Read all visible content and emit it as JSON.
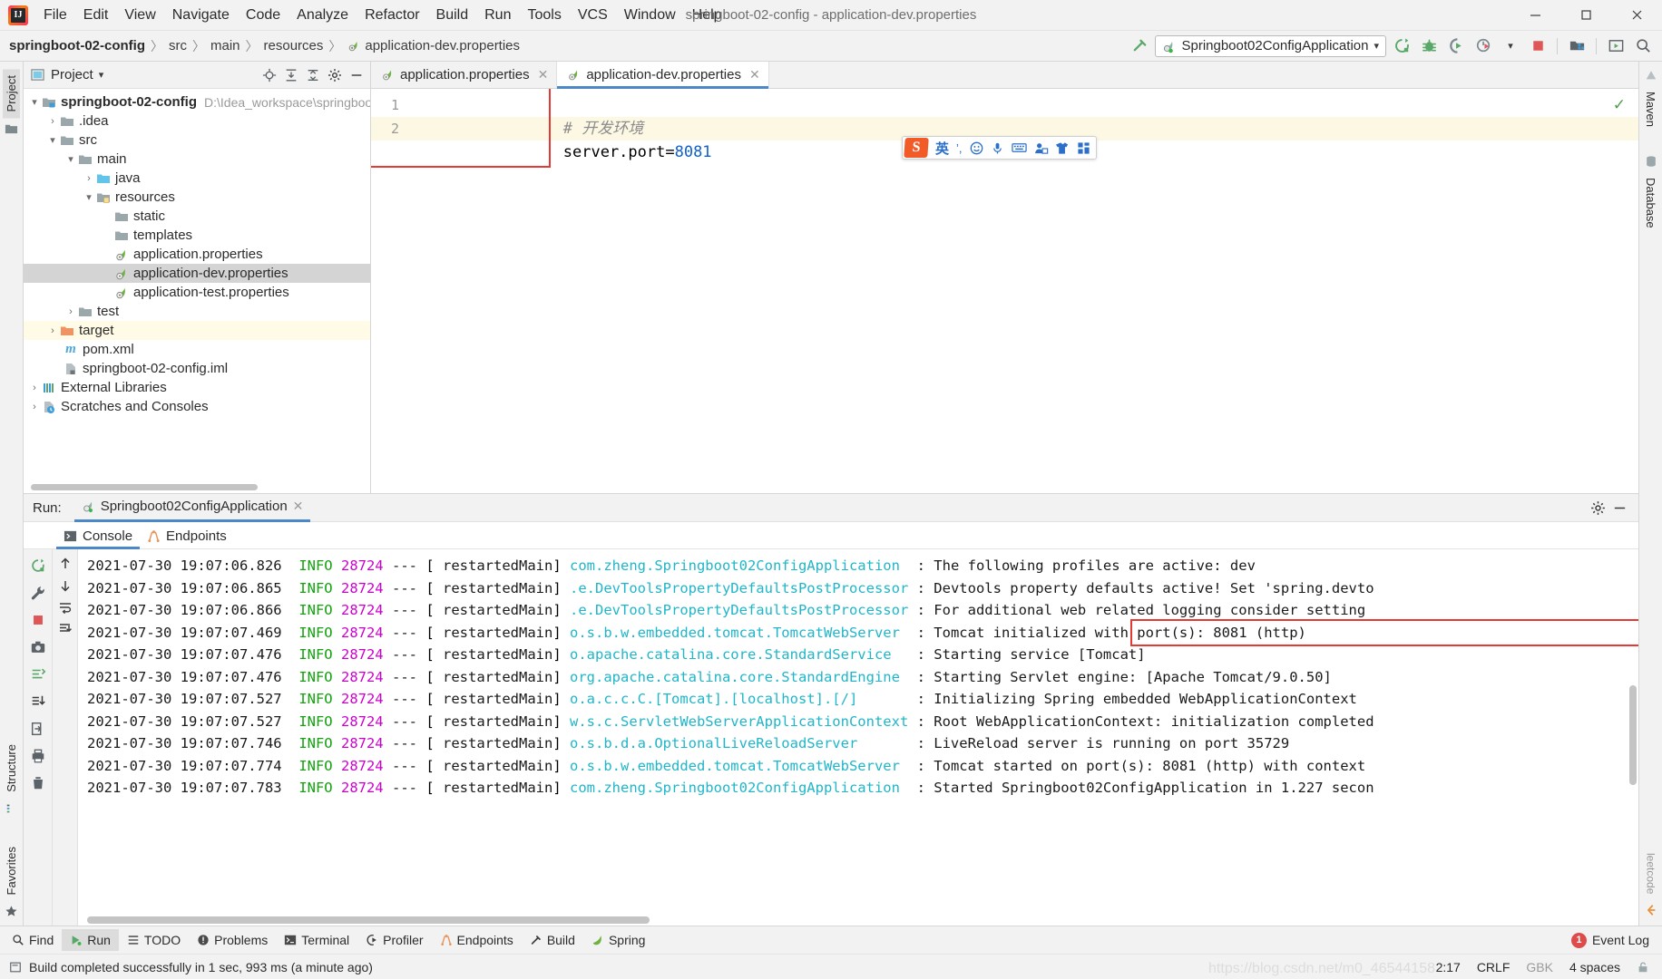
{
  "window": {
    "title": "springboot-02-config - application-dev.properties",
    "logo_text": "IJ",
    "minimize": "─",
    "maximize": "☐",
    "close": "✕"
  },
  "menubar": [
    {
      "label": "File"
    },
    {
      "label": "Edit"
    },
    {
      "label": "View"
    },
    {
      "label": "Navigate"
    },
    {
      "label": "Code"
    },
    {
      "label": "Analyze"
    },
    {
      "label": "Refactor"
    },
    {
      "label": "Build"
    },
    {
      "label": "Run"
    },
    {
      "label": "Tools"
    },
    {
      "label": "VCS"
    },
    {
      "label": "Window"
    },
    {
      "label": "Help"
    }
  ],
  "breadcrumb": {
    "items": [
      "springboot-02-config",
      "src",
      "main",
      "resources",
      "application-dev.properties"
    ],
    "separator": "〉"
  },
  "toolbar": {
    "run_config_name": "Springboot02ConfigApplication",
    "dropdown_caret": "▾",
    "icons": [
      {
        "name": "build-hammer-icon"
      },
      {
        "name": "rerun-icon"
      },
      {
        "name": "debug-icon"
      },
      {
        "name": "run-coverage-icon"
      },
      {
        "name": "profiler-icon"
      },
      {
        "name": "stop-icon"
      },
      {
        "name": "project-structure-icon"
      },
      {
        "name": "updates-icon"
      },
      {
        "name": "search-everywhere-icon"
      }
    ]
  },
  "left_rail": [
    {
      "label": "Project",
      "selected": true
    },
    {
      "label": "Favorites",
      "selected": false
    },
    {
      "label": "Structure",
      "selected": false
    }
  ],
  "right_rail": [
    {
      "label": "Maven"
    },
    {
      "label": "Database"
    }
  ],
  "project_panel": {
    "title": "Project",
    "caret": "▾",
    "header_icons": [
      "locate-icon",
      "expand-all-icon",
      "collapse-all-icon",
      "settings-gear-icon",
      "hide-icon"
    ],
    "tree": [
      {
        "depth": 0,
        "arrow": "v",
        "icon": "module-folder-icon",
        "label": "springboot-02-config",
        "bold": true,
        "path": "D:\\Idea_workspace\\springboot-",
        "state": "normal"
      },
      {
        "depth": 1,
        "arrow": ">",
        "icon": "folder-icon",
        "label": ".idea",
        "bold": false,
        "path": "",
        "state": "normal"
      },
      {
        "depth": 1,
        "arrow": "v",
        "icon": "folder-icon",
        "label": "src",
        "bold": false,
        "path": "",
        "state": "normal"
      },
      {
        "depth": 2,
        "arrow": "v",
        "icon": "folder-icon",
        "label": "main",
        "bold": false,
        "path": "",
        "state": "normal"
      },
      {
        "depth": 3,
        "arrow": ">",
        "icon": "source-folder-icon",
        "label": "java",
        "bold": false,
        "path": "",
        "state": "normal"
      },
      {
        "depth": 3,
        "arrow": "v",
        "icon": "resource-folder-icon",
        "label": "resources",
        "bold": false,
        "path": "",
        "state": "normal"
      },
      {
        "depth": 4,
        "arrow": "",
        "icon": "folder-icon",
        "label": "static",
        "bold": false,
        "path": "",
        "state": "normal"
      },
      {
        "depth": 4,
        "arrow": "",
        "icon": "folder-icon",
        "label": "templates",
        "bold": false,
        "path": "",
        "state": "normal"
      },
      {
        "depth": 4,
        "arrow": "",
        "icon": "spring-properties-icon",
        "label": "application.properties",
        "bold": false,
        "path": "",
        "state": "normal"
      },
      {
        "depth": 4,
        "arrow": "",
        "icon": "spring-properties-icon",
        "label": "application-dev.properties",
        "bold": false,
        "path": "",
        "state": "selected"
      },
      {
        "depth": 4,
        "arrow": "",
        "icon": "spring-properties-icon",
        "label": "application-test.properties",
        "bold": false,
        "path": "",
        "state": "normal"
      },
      {
        "depth": 2,
        "arrow": ">",
        "icon": "folder-icon",
        "label": "test",
        "bold": false,
        "path": "",
        "state": "normal"
      },
      {
        "depth": 1,
        "arrow": ">",
        "icon": "target-folder-icon",
        "label": "target",
        "bold": false,
        "path": "",
        "state": "highlight"
      },
      {
        "depth": 1,
        "arrow": "",
        "icon": "maven-pom-icon",
        "label": "pom.xml",
        "bold": false,
        "path": "",
        "state": "normal"
      },
      {
        "depth": 1,
        "arrow": "",
        "icon": "iml-icon",
        "label": "springboot-02-config.iml",
        "bold": false,
        "path": "",
        "state": "normal"
      },
      {
        "depth": 0,
        "arrow": ">",
        "icon": "external-libraries-icon",
        "label": "External Libraries",
        "bold": false,
        "path": "",
        "state": "normal"
      },
      {
        "depth": 0,
        "arrow": ">",
        "icon": "scratches-icon",
        "label": "Scratches and Consoles",
        "bold": false,
        "path": "",
        "state": "normal"
      }
    ]
  },
  "editor": {
    "tabs": [
      {
        "label": "application.properties",
        "icon": "spring-properties-icon",
        "active": false,
        "close": "✕"
      },
      {
        "label": "application-dev.properties",
        "icon": "spring-properties-icon",
        "active": true,
        "close": "✕"
      }
    ],
    "gutter": [
      "1",
      "2"
    ],
    "lines": [
      {
        "num": "1",
        "segments": [
          {
            "text": "# 开发环境",
            "cls": "cmt"
          }
        ],
        "highlight": false
      },
      {
        "num": "2",
        "segments": [
          {
            "text": "server.port=",
            "cls": "plain"
          },
          {
            "text": "8081",
            "cls": "num"
          }
        ],
        "highlight": true
      }
    ],
    "inspection_status": "✓",
    "ime": {
      "logo": "S",
      "mode": "英",
      "items": [
        "punctuation-icon",
        "emoji-icon",
        "microphone-icon",
        "keyboard-icon",
        "user-icon",
        "skin-icon",
        "apps-icon"
      ],
      "mode_punct": "’,"
    }
  },
  "run_tool": {
    "label": "Run:",
    "config_tab": "Springboot02ConfigApplication",
    "config_tab_close": "✕",
    "tabs": [
      {
        "label": "Console",
        "icon": "console-icon",
        "active": true
      },
      {
        "label": "Endpoints",
        "icon": "endpoints-icon",
        "active": false
      }
    ],
    "header_icons": [
      "settings-gear-icon",
      "hide-icon"
    ],
    "side_icons": [
      "rerun-icon",
      "stop-icon",
      "screenshot-icon",
      "thread-dump-icon",
      "export-icon",
      "print-icon",
      "trash-icon"
    ],
    "gutter_icons": [
      "scroll-up-icon",
      "scroll-down-icon",
      "soft-wrap-icon",
      "scroll-to-end-icon"
    ],
    "console_lines": [
      {
        "date": "2021-07-30 19:07:06.826",
        "level": "INFO",
        "pid": "28724",
        "thread": "restartedMain",
        "logger": "com.zheng.Springboot02ConfigApplication",
        "message": ": The following profiles are active: dev",
        "highlight": false
      },
      {
        "date": "2021-07-30 19:07:06.865",
        "level": "INFO",
        "pid": "28724",
        "thread": "restartedMain",
        "logger": ".e.DevToolsPropertyDefaultsPostProcessor",
        "message": ": Devtools property defaults active! Set 'spring.devto",
        "highlight": false
      },
      {
        "date": "2021-07-30 19:07:06.866",
        "level": "INFO",
        "pid": "28724",
        "thread": "restartedMain",
        "logger": ".e.DevToolsPropertyDefaultsPostProcessor",
        "message": ": For additional web related logging consider setting",
        "highlight": false
      },
      {
        "date": "2021-07-30 19:07:07.469",
        "level": "INFO",
        "pid": "28724",
        "thread": "restartedMain",
        "logger": "o.s.b.w.embedded.tomcat.TomcatWebServer",
        "message": ": Tomcat initialized with port(s): 8081 (http)",
        "highlight": true
      },
      {
        "date": "2021-07-30 19:07:07.476",
        "level": "INFO",
        "pid": "28724",
        "thread": "restartedMain",
        "logger": "o.apache.catalina.core.StandardService",
        "message": ": Starting service [Tomcat]",
        "highlight": false
      },
      {
        "date": "2021-07-30 19:07:07.476",
        "level": "INFO",
        "pid": "28724",
        "thread": "restartedMain",
        "logger": "org.apache.catalina.core.StandardEngine",
        "message": ": Starting Servlet engine: [Apache Tomcat/9.0.50]",
        "highlight": false
      },
      {
        "date": "2021-07-30 19:07:07.527",
        "level": "INFO",
        "pid": "28724",
        "thread": "restartedMain",
        "logger": "o.a.c.c.C.[Tomcat].[localhost].[/]",
        "message": ": Initializing Spring embedded WebApplicationContext",
        "highlight": false
      },
      {
        "date": "2021-07-30 19:07:07.527",
        "level": "INFO",
        "pid": "28724",
        "thread": "restartedMain",
        "logger": "w.s.c.ServletWebServerApplicationContext",
        "message": ": Root WebApplicationContext: initialization completed",
        "highlight": false
      },
      {
        "date": "2021-07-30 19:07:07.746",
        "level": "INFO",
        "pid": "28724",
        "thread": "restartedMain",
        "logger": "o.s.b.d.a.OptionalLiveReloadServer",
        "message": ": LiveReload server is running on port 35729",
        "highlight": false
      },
      {
        "date": "2021-07-30 19:07:07.774",
        "level": "INFO",
        "pid": "28724",
        "thread": "restartedMain",
        "logger": "o.s.b.w.embedded.tomcat.TomcatWebServer",
        "message": ": Tomcat started on port(s): 8081 (http) with context",
        "highlight": false
      },
      {
        "date": "2021-07-30 19:07:07.783",
        "level": "INFO",
        "pid": "28724",
        "thread": "restartedMain",
        "logger": "com.zheng.Springboot02ConfigApplication",
        "message": ": Started Springboot02ConfigApplication in 1.227 secon",
        "highlight": false
      }
    ]
  },
  "statusbar": {
    "tools": [
      {
        "label": "Find",
        "icon": "search-icon",
        "selected": false
      },
      {
        "label": "Run",
        "icon": "run-icon",
        "selected": true
      },
      {
        "label": "TODO",
        "icon": "todo-icon",
        "selected": false
      },
      {
        "label": "Problems",
        "icon": "problems-icon",
        "selected": false
      },
      {
        "label": "Terminal",
        "icon": "terminal-icon",
        "selected": false
      },
      {
        "label": "Profiler",
        "icon": "profiler-icon",
        "selected": false
      },
      {
        "label": "Endpoints",
        "icon": "endpoints-icon",
        "selected": false
      },
      {
        "label": "Build",
        "icon": "build-icon",
        "selected": false
      },
      {
        "label": "Spring",
        "icon": "spring-icon",
        "selected": false
      }
    ],
    "event_log": {
      "label": "Event Log",
      "count": "1"
    },
    "message": "Build completed successfully in 1 sec, 993 ms (a minute ago)",
    "caret_position": "2:17",
    "line_separator": "CRLF",
    "encoding": "GBK",
    "indent": "4 spaces",
    "lock_icon": "lock-icon"
  },
  "colors": {
    "accent_blue": "#4a88c7",
    "green": "#13a10e",
    "magenta": "#cc00cc",
    "cyan": "#1fb6c9",
    "red_highlight": "#e53935",
    "selection_grey": "#d4d4d4",
    "highlight_yellow": "#fffbe6"
  }
}
